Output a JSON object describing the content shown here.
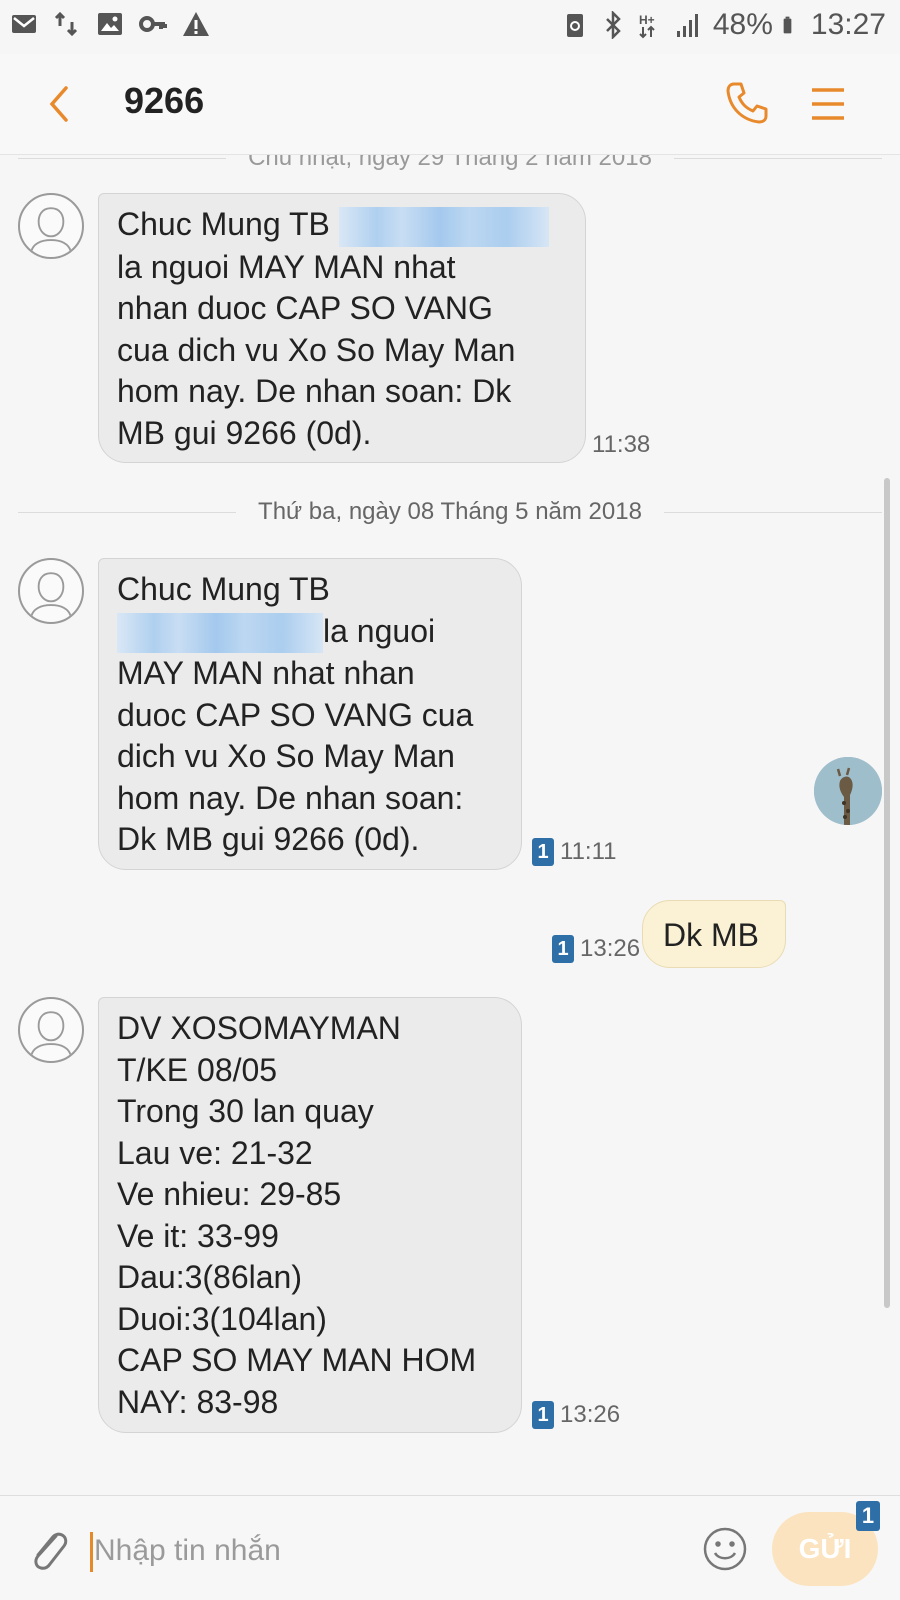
{
  "status_bar": {
    "left_icons": [
      "mail-icon",
      "data-transfer-icon",
      "image-icon",
      "key-icon",
      "warning-icon"
    ],
    "right_icons": [
      "battery-saver-icon",
      "bluetooth-icon",
      "network-hplus-icon",
      "signal-icon",
      "battery-icon"
    ],
    "battery": "48%",
    "time": "13:27"
  },
  "header": {
    "title": "9266",
    "back_icon": "chevron-left-icon",
    "call_icon": "phone-icon",
    "menu_icon": "menu-icon",
    "accent_color": "#e8892b"
  },
  "thread": {
    "date_separators": [
      "Chủ nhật, ngày 29 Tháng 2 năm 2018",
      "Thứ ba, ngày 08 Tháng 5 năm 2018"
    ],
    "messages": [
      {
        "direction": "incoming",
        "line1": "Chuc Mung TB ",
        "text_after_redaction": "\nla nguoi MAY MAN nhat\nnhan duoc CAP SO VANG\ncua dich vu Xo So May Man\nhom nay. De nhan soan: Dk\nMB gui 9266 (0d).",
        "time": "11:38",
        "sim": ""
      },
      {
        "direction": "incoming",
        "line1": "Chuc Mung TB",
        "text_after_redaction": "la nguoi\nMAY MAN nhat nhan\nduoc CAP SO VANG cua\ndich vu Xo So May Man\nhom nay. De nhan soan:\nDk MB gui 9266 (0d).",
        "time": "11:11",
        "sim": "1"
      },
      {
        "direction": "outgoing",
        "text": "Dk MB",
        "time": "13:26",
        "sim": "1"
      },
      {
        "direction": "incoming",
        "text": "DV XOSOMAYMAN\nT/KE 08/05\nTrong 30 lan quay\nLau ve: 21-32\nVe nhieu: 29-85\nVe it: 33-99\nDau:3(86lan)\nDuoi:3(104lan)\nCAP SO MAY MAN HOM\nNAY: 83-98",
        "time": "13:26",
        "sim": "1"
      }
    ]
  },
  "composer": {
    "placeholder": "Nhập tin nhắn",
    "value": "",
    "send_label": "GỬI",
    "send_sim": "1",
    "attach_icon": "paperclip-icon",
    "emoji_icon": "emoji-icon"
  }
}
